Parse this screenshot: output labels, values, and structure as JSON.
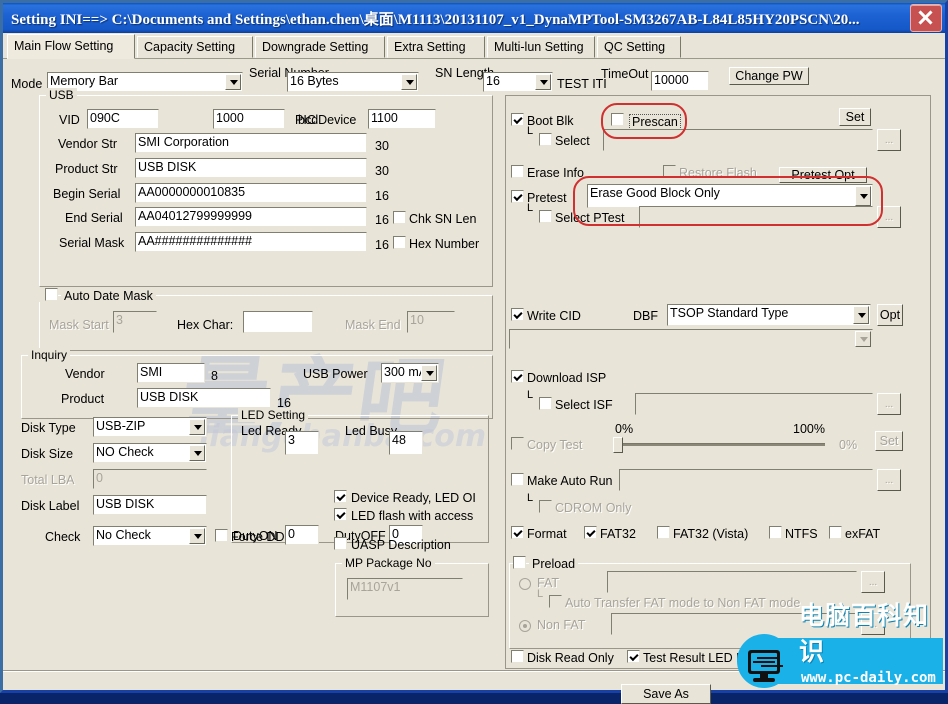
{
  "window": {
    "title": "Setting  INI==> C:\\Documents and Settings\\ethan.chen\\桌面\\M1113\\20131107_v1_DynaMPTool-SM3267AB-L84L85HY20PSCN\\20...",
    "close_label": "close-icon"
  },
  "tabs": [
    {
      "label": "Main Flow Setting",
      "active": true
    },
    {
      "label": "Capacity Setting",
      "active": false
    },
    {
      "label": "Downgrade Setting",
      "active": false
    },
    {
      "label": "Extra Setting",
      "active": false
    },
    {
      "label": "Multi-lun Setting",
      "active": false
    },
    {
      "label": "QC Setting",
      "active": false
    }
  ],
  "top": {
    "mode_label": "Mode",
    "mode_value": "Memory Bar",
    "serial_number_label": "Serial Number",
    "serial_number_value": "16 Bytes",
    "sn_length_label": "SN Length",
    "sn_length_value": "16",
    "test_iti_label": "TEST ITI",
    "timeout_label": "TimeOut",
    "timeout_value": "10000",
    "change_pw_label": "Change PW"
  },
  "usb": {
    "title": "USB",
    "vid_label": "VID",
    "vid_value": "090C",
    "pic_label": "PIC",
    "pic_value": "1000",
    "bcd_label": "bcdDevice",
    "bcd_value": "1100",
    "vendor_str_label": "Vendor Str",
    "vendor_str_value": "SMI Corporation",
    "vendor_str_len": "30",
    "product_str_label": "Product Str",
    "product_str_value": "USB DISK",
    "product_str_len": "30",
    "begin_serial_label": "Begin Serial",
    "begin_serial_value": "AA0000000010835",
    "begin_serial_len": "16",
    "end_serial_label": "End Serial",
    "end_serial_value": "AA04012799999999",
    "end_serial_len": "16",
    "serial_mask_label": "Serial Mask",
    "serial_mask_value": "AA##############",
    "serial_mask_len": "16",
    "chk_sn_len_label": "Chk SN Len",
    "chk_sn_len_checked": false,
    "hex_number_label": "Hex Number",
    "hex_number_checked": false
  },
  "auto_date_mask": {
    "title": "Auto Date Mask",
    "checked": false,
    "mask_start_label": "Mask Start",
    "mask_start_value": "3",
    "hex_char_label": "Hex Char:",
    "hex_char_value": "",
    "mask_end_label": "Mask End",
    "mask_end_value": "10"
  },
  "inquiry": {
    "title": "Inquiry",
    "vendor_label": "Vendor",
    "vendor_value": "SMI",
    "vendor_len": "8",
    "product_label": "Product",
    "product_value": "USB DISK",
    "product_len": "16",
    "usb_power_label": "USB Power",
    "usb_power_value": "300 mA"
  },
  "disk": {
    "disk_type_label": "Disk Type",
    "disk_type_value": "USB-ZIP",
    "disk_size_label": "Disk Size",
    "disk_size_value": "NO Check",
    "total_lba_label": "Total LBA",
    "total_lba_value": "0",
    "disk_label_label": "Disk Label",
    "disk_label_value": "USB DISK",
    "check_label": "Check",
    "check_value": "No Check",
    "force_ddr_label": "Force DDR",
    "force_ddr_checked": false
  },
  "led": {
    "title": "LED Setting",
    "led_ready_label": "Led Ready",
    "led_ready_value": "3",
    "led_busy_label": "Led Busy",
    "led_busy_value": "48",
    "duty_on_label": "DutyON",
    "duty_on_value": "0",
    "duty_off_label": "DutyOFF",
    "duty_off_value": "0",
    "device_ready_label": "Device Ready, LED OI",
    "device_ready_checked": true,
    "led_flash_label": "LED flash with access",
    "led_flash_checked": true
  },
  "uasp": {
    "label": "UASP Description",
    "checked": false,
    "mp_package_title": "MP Package No",
    "mp_package_value": "M1107v1"
  },
  "right": {
    "boot_blk_label": "Boot Blk",
    "boot_blk_checked": true,
    "prescan_label": "Prescan",
    "prescan_checked": false,
    "set_label": "Set",
    "boot_select_label": "Select",
    "boot_select_checked": false,
    "boot_select_value": "",
    "ellipsis_label": "...",
    "erase_info_label": "Erase Info",
    "erase_info_checked": false,
    "restore_flash_label": "Restore Flash",
    "restore_flash_checked": false,
    "pretest_opt_label": "Pretest Opt",
    "pretest_label": "Pretest",
    "pretest_checked": true,
    "pretest_value": "Erase Good Block Only",
    "select_ptest_label": "Select PTest",
    "select_ptest_checked": false,
    "select_ptest_value": "",
    "write_cid_label": "Write CID",
    "write_cid_checked": true,
    "dbf_label": "DBF",
    "dbf_value": "TSOP Standard Type",
    "opt_label": "Opt",
    "cid_second_value": "",
    "download_isp_label": "Download ISP",
    "download_isp_checked": true,
    "select_isp_label": "Select ISF",
    "select_isp_checked": false,
    "select_isp_value": "",
    "copy_test_label": "Copy Test",
    "copy_test_checked": false,
    "copy_min_label": "0%",
    "copy_max_label": "100%",
    "copy_value_label": "0%",
    "copy_set_label": "Set",
    "copy_percent": 0,
    "make_auto_run_label": "Make Auto Run",
    "make_auto_run_checked": false,
    "make_auto_run_value": "",
    "cdrom_only_label": "CDROM Only",
    "cdrom_only_checked": false,
    "format_label": "Format",
    "format_checked": true,
    "fat32_label": "FAT32",
    "fat32_checked": true,
    "fat32_vista_label": "FAT32 (Vista)",
    "fat32_vista_checked": false,
    "ntfs_label": "NTFS",
    "ntfs_checked": false,
    "exfat_label": "exFAT",
    "exfat_checked": false,
    "preload_label": "Preload",
    "preload_checked": false,
    "fat_label": "FAT",
    "fat_selected": false,
    "fat_value": "",
    "auto_transfer_label": "Auto Transfer FAT mode to Non FAT mode",
    "auto_transfer_checked": false,
    "non_fat_label": "Non FAT",
    "non_fat_selected": true,
    "non_fat_value": "",
    "disk_read_only_label": "Disk Read Only",
    "disk_read_only_checked": false,
    "test_result_led_label": "Test Result LED Flash",
    "test_result_led_checked": true
  },
  "footer": {
    "save_as_label": "Save  As"
  },
  "logo": {
    "cn_text": "电脑百科知识",
    "url_text": "www.pc-daily.com"
  },
  "watermark": {
    "cn": "量产吧",
    "url": "liangchanba.com"
  },
  "colors": {
    "face": "#e8e4d8",
    "title_blue": "#1558c8",
    "highlight_red": "#d03030",
    "logo_blue": "#1ab0e8"
  }
}
